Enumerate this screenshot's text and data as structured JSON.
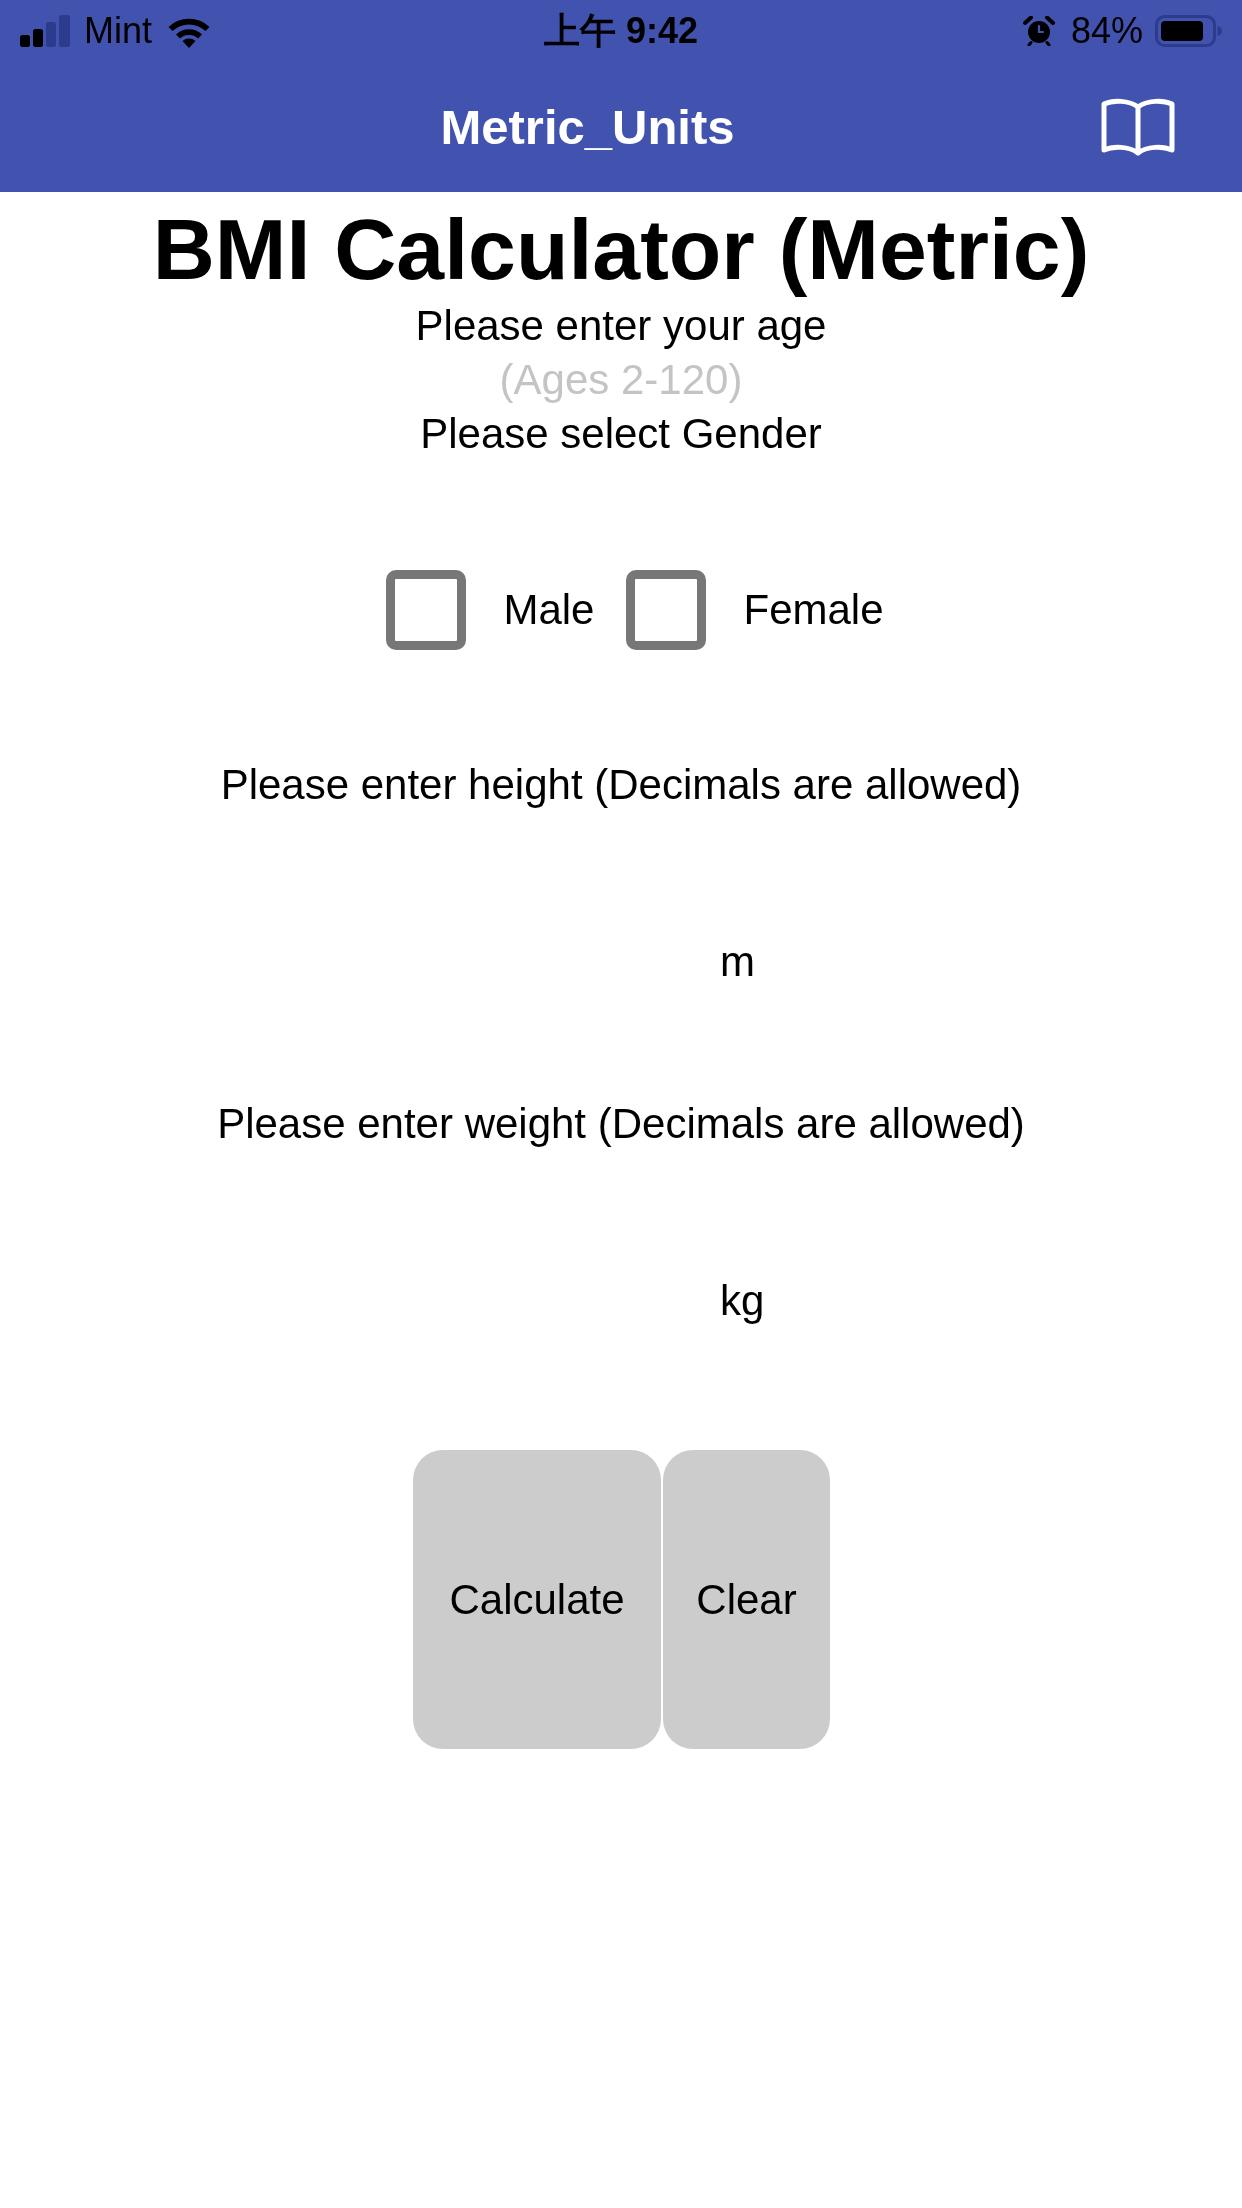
{
  "status_bar": {
    "carrier": "Mint",
    "time": "上午 9:42",
    "battery": "84%"
  },
  "nav_bar": {
    "title": "Metric_Units"
  },
  "heading": "BMI Calculator (Metric)",
  "age": {
    "label": "Please enter your age",
    "placeholder": "(Ages 2-120)"
  },
  "gender": {
    "label": "Please select Gender",
    "options": [
      {
        "label": "Male",
        "checked": false
      },
      {
        "label": "Female",
        "checked": false
      }
    ]
  },
  "height": {
    "label": "Please enter height (Decimals are allowed)",
    "unit": "m"
  },
  "weight": {
    "label": "Please enter weight (Decimals are allowed)",
    "unit": "kg"
  },
  "buttons": [
    {
      "label": "Calculate"
    },
    {
      "label": "Clear"
    }
  ]
}
